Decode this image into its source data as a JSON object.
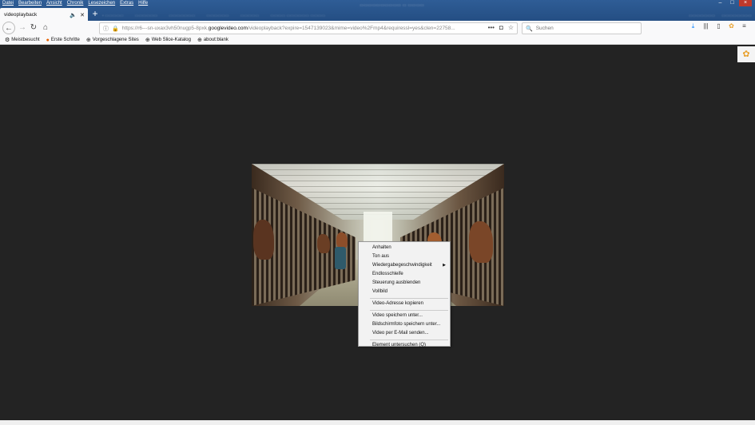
{
  "menubar": [
    "Datei",
    "Bearbeiten",
    "Ansicht",
    "Chronik",
    "Lesezeichen",
    "Extras",
    "Hilfe"
  ],
  "tab": {
    "title": "videoplayback",
    "audio_icon": "speaker-icon",
    "close_icon": "close-icon"
  },
  "newtab_label": "+",
  "url": {
    "prefix": "https://r6---sn-uxax3vh50nugp5-8pxk.",
    "domain": "googlevideo.com",
    "path": "/videoplayback?expire=1547139023&mime=video%2Fmp4&requiressl=yes&clen=22758..."
  },
  "search": {
    "placeholder": "Suchen"
  },
  "bookmarks": [
    {
      "label": "Meistbesucht",
      "icon": "gear-icon"
    },
    {
      "label": "Erste Schritte",
      "icon": "firefox-icon"
    },
    {
      "label": "Vorgeschlagene Sites",
      "icon": "globe-icon"
    },
    {
      "label": "Web Slice-Katalog",
      "icon": "globe-icon"
    },
    {
      "label": "about:blank",
      "icon": "globe-icon"
    }
  ],
  "context_menu": {
    "items": [
      {
        "label": "Anhalten",
        "key": "A"
      },
      {
        "label": "Ton aus",
        "key": "T"
      },
      {
        "label": "Wiedergabegeschwindigkeit",
        "key": "g",
        "submenu": true
      },
      {
        "label": "Endlosschleife",
        "key": "f"
      },
      {
        "label": "Steuerung ausblenden",
        "key": "S"
      },
      {
        "label": "Vollbild",
        "key": "V"
      },
      {
        "label": "Video-Adresse kopieren",
        "key": "o",
        "sep_before": true
      },
      {
        "label": "Video speichern unter...",
        "key": "u",
        "sep_before": true
      },
      {
        "label": "Bildschirmfoto speichern unter...",
        "key": "B"
      },
      {
        "label": "Video per E-Mail senden...",
        "key": "n"
      },
      {
        "label": "Element untersuchen (Q)",
        "key": "Q",
        "sep_before": true
      }
    ]
  }
}
